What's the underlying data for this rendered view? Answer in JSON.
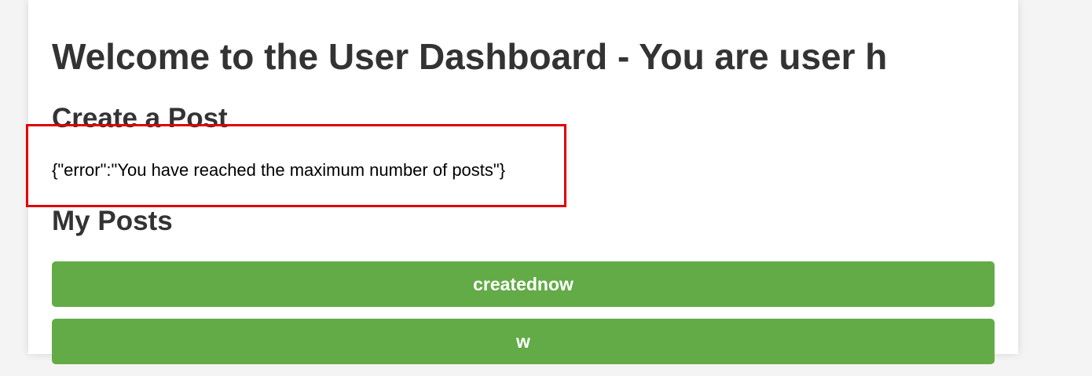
{
  "header": {
    "title": "Welcome to the User Dashboard - You are user h"
  },
  "create_post": {
    "heading": "Create a Post",
    "response_text": "{\"error\":\"You have reached the maximum number of posts\"}"
  },
  "my_posts": {
    "heading": "My Posts",
    "posts": [
      {
        "label": "creatednow"
      },
      {
        "label": "w"
      }
    ]
  },
  "colors": {
    "post_button": "#63ab47",
    "highlight_border": "#e00000",
    "heading_text": "#333333"
  }
}
